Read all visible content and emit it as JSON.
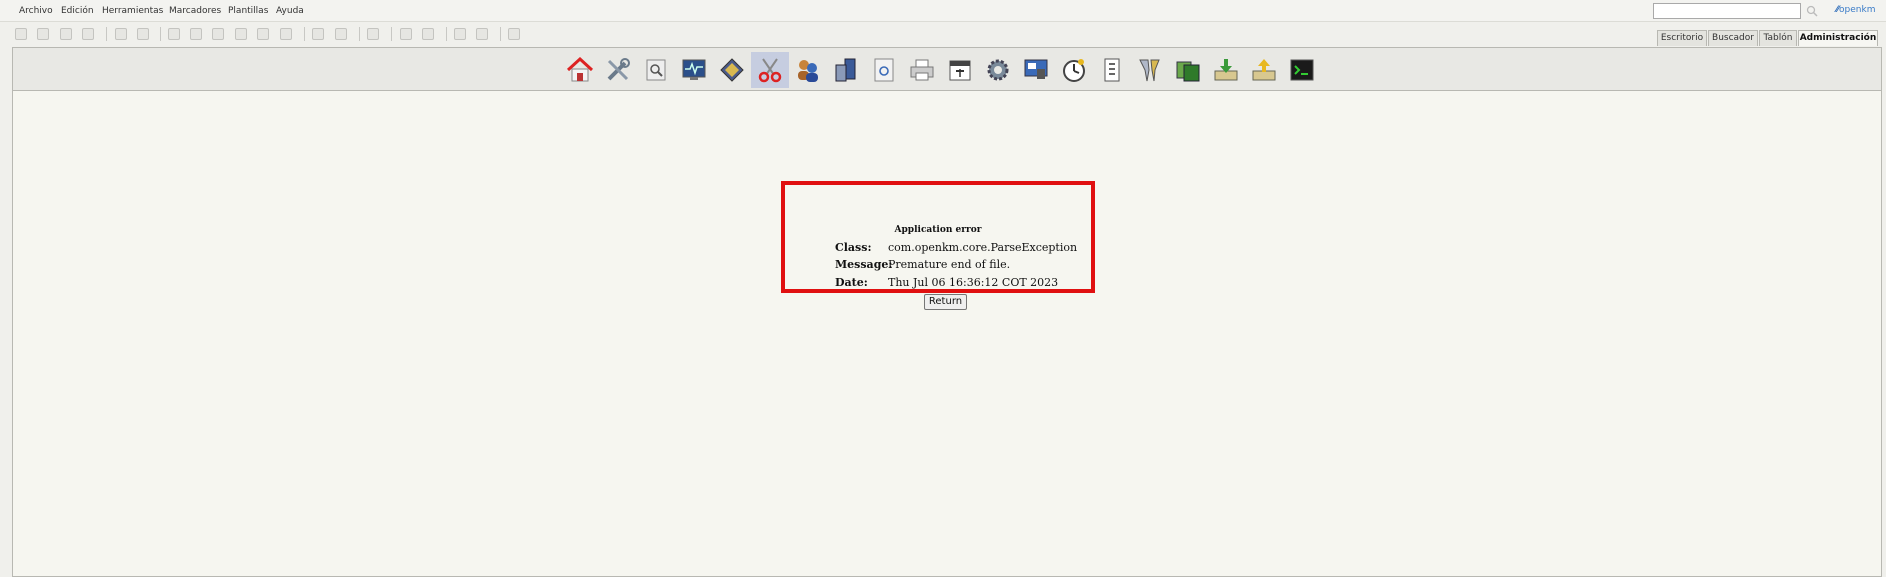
{
  "menu": {
    "items": [
      {
        "label": "Archivo"
      },
      {
        "label": "Edición"
      },
      {
        "label": "Herramientas"
      },
      {
        "label": "Marcadores"
      },
      {
        "label": "Plantillas"
      },
      {
        "label": "Ayuda"
      }
    ]
  },
  "search": {
    "value": "",
    "placeholder": ""
  },
  "logo": {
    "text": "openkm"
  },
  "tabs": [
    {
      "label": "Escritorio"
    },
    {
      "label": "Buscador"
    },
    {
      "label": "Tablón"
    },
    {
      "label": "Administración",
      "active": true
    }
  ],
  "admin_toolbar": {
    "icons": [
      "home-icon",
      "tools-icon",
      "search-icon",
      "monitor-icon",
      "diamond-icon",
      "scissors-icon",
      "users-icon",
      "database-icon",
      "document-search-icon",
      "printer-icon",
      "calendar-icon",
      "gear-icon",
      "screen-icon",
      "clock-icon",
      "list-icon",
      "filter-icon",
      "folders-icon",
      "download-icon",
      "upload-icon",
      "terminal-icon"
    ],
    "active": "scissors-icon"
  },
  "error": {
    "title": "Application error",
    "class_label": "Class:",
    "class_value": "com.openkm.core.ParseException",
    "message_label": "Message:",
    "message_value": "Premature end of file.",
    "date_label": "Date:",
    "date_value": "Thu Jul 06 16:36:12 COT 2023"
  },
  "return_button": {
    "label": "Return"
  },
  "colors": {
    "highlight_border": "#e01010",
    "active_icon_bg": "#c6cde0"
  }
}
